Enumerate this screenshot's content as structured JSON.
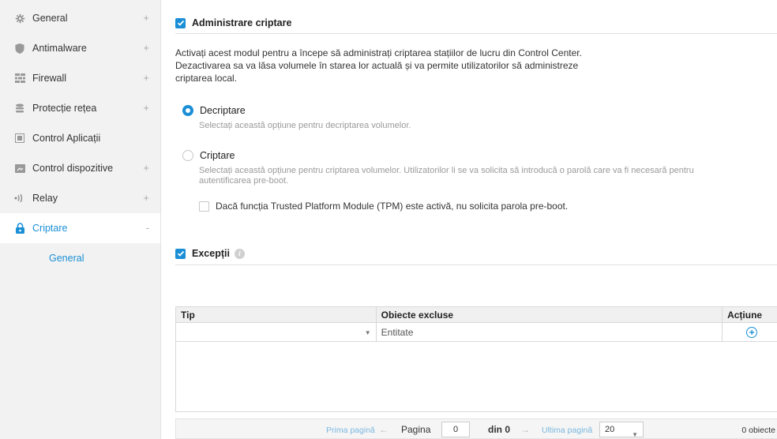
{
  "sidebar": {
    "items": [
      {
        "label": "General",
        "icon": "gear-icon",
        "expand": "+"
      },
      {
        "label": "Antimalware",
        "icon": "shield-icon",
        "expand": "+"
      },
      {
        "label": "Firewall",
        "icon": "firewall-icon",
        "expand": "+"
      },
      {
        "label": "Protecție rețea",
        "icon": "network-icon",
        "expand": "+"
      },
      {
        "label": "Control Aplicații",
        "icon": "app-control-icon",
        "expand": ""
      },
      {
        "label": "Control dispozitive",
        "icon": "device-icon",
        "expand": "+"
      },
      {
        "label": "Relay",
        "icon": "relay-icon",
        "expand": "+"
      },
      {
        "label": "Criptare",
        "icon": "lock-icon",
        "expand": "-"
      }
    ],
    "sub_item": "General",
    "active_color": "#1a8fd6"
  },
  "encryption": {
    "title": "Administrare criptare",
    "description": "Activați acest modul pentru a începe să administrați criptarea stațiilor de lucru din Control Center. Dezactivarea sa va lăsa volumele în starea lor actuală și va permite utilizatorilor să administreze criptarea local.",
    "decrypt_label": "Decriptare",
    "decrypt_hint": "Selectați această opțiune pentru decriptarea volumelor.",
    "encrypt_label": "Criptare",
    "encrypt_hint": "Selectați această opțiune pentru criptarea volumelor. Utilizatorilor li se va solicita să introducă o parolă care va fi necesară pentru autentificarea pre-boot.",
    "tpm_label": "Dacă funcția Trusted Platform Module (TPM) este activă, nu solicita parola pre-boot."
  },
  "exceptions": {
    "title": "Excepții",
    "columns": {
      "type": "Tip",
      "excluded": "Obiecte excluse",
      "action": "Acțiune"
    },
    "entity_placeholder": "Entitate"
  },
  "pager": {
    "first": "Prima pagină",
    "page_label": "Pagina",
    "page_value": "0",
    "of_label": "din 0",
    "last": "Ultima pagină",
    "per_page": "20",
    "count": "0 obiecte"
  }
}
